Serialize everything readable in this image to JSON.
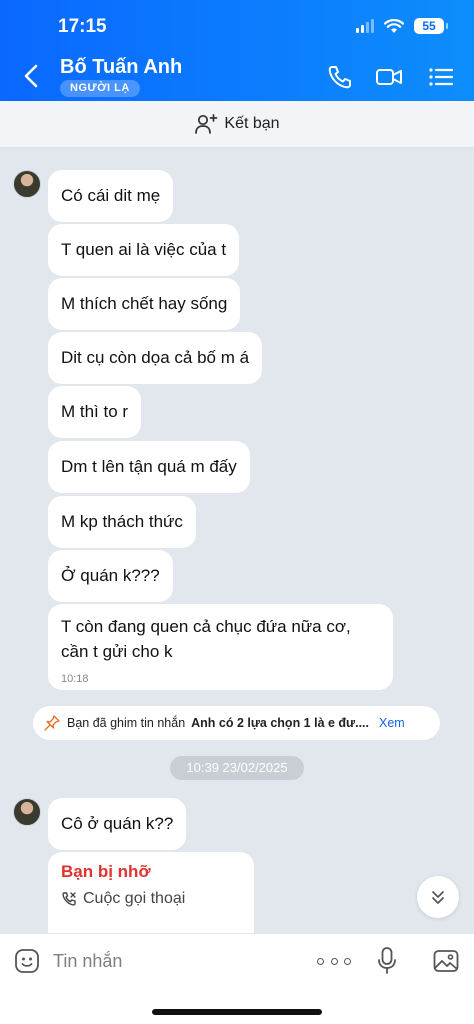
{
  "status_bar": {
    "time": "17:15",
    "battery": "55"
  },
  "header": {
    "contact_name": "Bố Tuấn Anh",
    "badge": "NGƯỜI LẠ",
    "icons": [
      "back-icon",
      "phone-icon",
      "video-call-icon",
      "list-menu-icon"
    ]
  },
  "friend_bar": {
    "label": "Kết bạn",
    "icon": "add-user-icon"
  },
  "messages": [
    {
      "text": "Có cái dit mẹ"
    },
    {
      "text": "T quen ai là việc của t"
    },
    {
      "text": "M thích chết hay sống"
    },
    {
      "text": "Dit cụ còn dọa cả bố m á"
    },
    {
      "text": "M thì to r"
    },
    {
      "text": "Dm t lên tận quá m đấy"
    },
    {
      "text": "M kp thách thức"
    },
    {
      "text": "Ở quán k???"
    },
    {
      "text": "T còn đang quen cả chục đứa nữa cơ, cần t gửi cho k",
      "time": "10:18"
    }
  ],
  "pinned": {
    "prefix": "Bạn đã ghim tin nhắn",
    "message": "Anh có 2 lựa chọn 1 là e đư....",
    "action": "Xem"
  },
  "date_separator": "10:39 23/02/2025",
  "messages_after": [
    {
      "text": "Cô ở quán k??"
    }
  ],
  "call_card": {
    "title": "Bạn bị nhỡ",
    "type": "Cuộc gọi thoại"
  },
  "composer": {
    "placeholder": "Tin nhắn"
  },
  "colors": {
    "header_start": "#0a68ff",
    "header_end": "#0d8dfc",
    "missed": "#e0322f",
    "link": "#1565e8"
  }
}
